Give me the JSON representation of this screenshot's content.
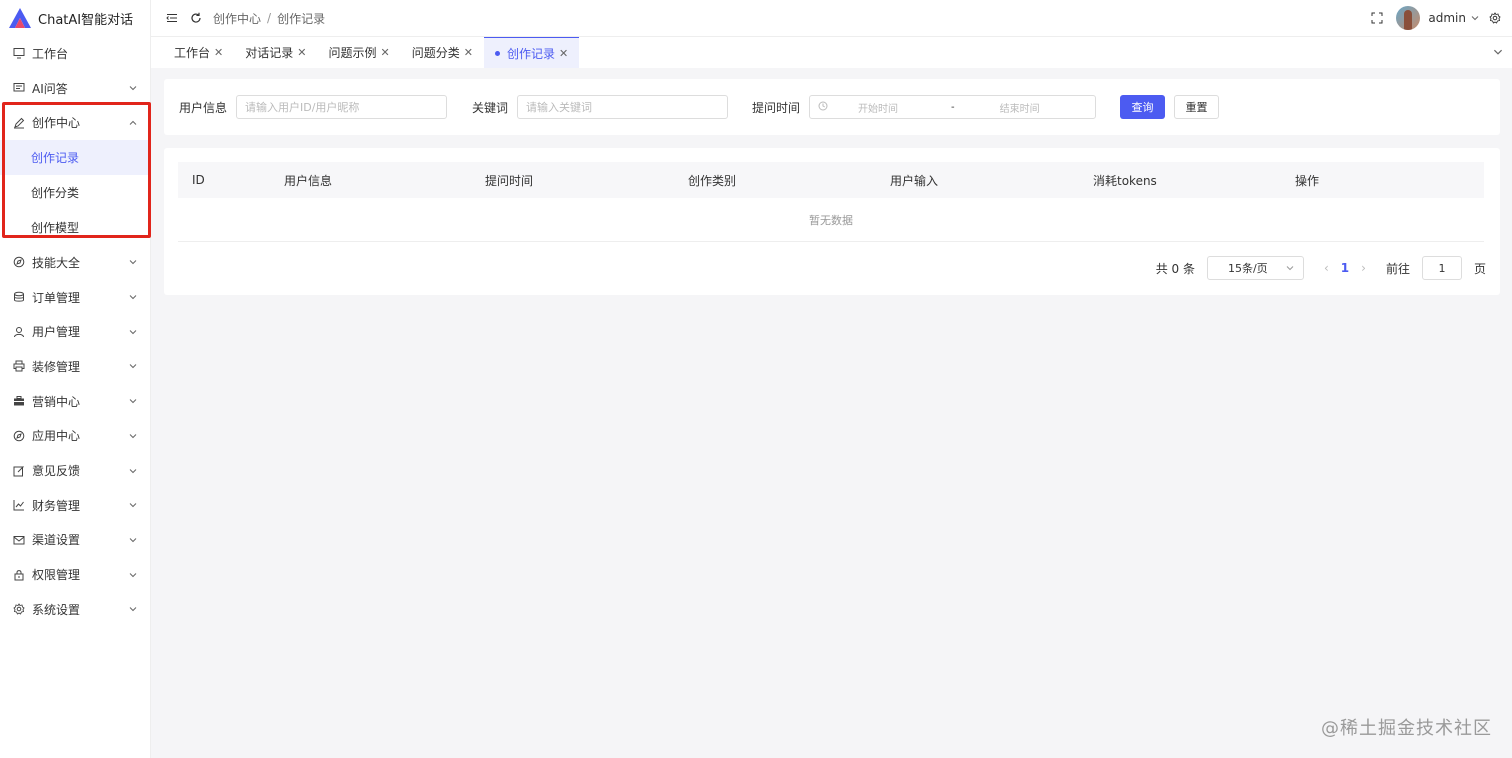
{
  "app": {
    "title": "ChatAI智能对话"
  },
  "colors": {
    "accent": "#4c5bf1",
    "highlight_border": "#e1251b"
  },
  "sidebar": {
    "items": [
      {
        "label": "工作台",
        "icon": "monitor-icon",
        "expandable": false
      },
      {
        "label": "AI问答",
        "icon": "chat-icon",
        "expandable": true
      },
      {
        "label": "创作中心",
        "icon": "pen-icon",
        "expandable": true,
        "expanded": true,
        "children": [
          {
            "label": "创作记录",
            "active": true
          },
          {
            "label": "创作分类"
          },
          {
            "label": "创作模型"
          }
        ]
      },
      {
        "label": "技能大全",
        "icon": "compass-icon",
        "expandable": true
      },
      {
        "label": "订单管理",
        "icon": "database-icon",
        "expandable": true
      },
      {
        "label": "用户管理",
        "icon": "user-icon",
        "expandable": true
      },
      {
        "label": "装修管理",
        "icon": "printer-icon",
        "expandable": true
      },
      {
        "label": "营销中心",
        "icon": "briefcase-icon",
        "expandable": true
      },
      {
        "label": "应用中心",
        "icon": "compass-icon",
        "expandable": true
      },
      {
        "label": "意见反馈",
        "icon": "edit-icon",
        "expandable": true
      },
      {
        "label": "财务管理",
        "icon": "chart-icon",
        "expandable": true
      },
      {
        "label": "渠道设置",
        "icon": "mail-icon",
        "expandable": true
      },
      {
        "label": "权限管理",
        "icon": "lock-icon",
        "expandable": true
      },
      {
        "label": "系统设置",
        "icon": "gear-icon",
        "expandable": true
      }
    ]
  },
  "header": {
    "breadcrumb": [
      "创作中心",
      "创作记录"
    ],
    "username": "admin"
  },
  "tabs": [
    {
      "label": "工作台",
      "active": false
    },
    {
      "label": "对话记录",
      "active": false
    },
    {
      "label": "问题示例",
      "active": false
    },
    {
      "label": "问题分类",
      "active": false
    },
    {
      "label": "创作记录",
      "active": true
    }
  ],
  "filter": {
    "user_label": "用户信息",
    "user_placeholder": "请输入用户ID/用户昵称",
    "keyword_label": "关键词",
    "keyword_placeholder": "请输入关键词",
    "time_label": "提问时间",
    "start_placeholder": "开始时间",
    "range_sep": "-",
    "end_placeholder": "结束时间",
    "query_button": "查询",
    "reset_button": "重置"
  },
  "table": {
    "columns": [
      "ID",
      "用户信息",
      "提问时间",
      "创作类别",
      "用户输入",
      "消耗tokens",
      "操作"
    ],
    "empty_text": "暂无数据"
  },
  "pagination": {
    "total_text": "共 0 条",
    "page_size": "15条/页",
    "current_page": "1",
    "goto_label": "前往",
    "goto_value": "1",
    "page_unit": "页"
  },
  "watermark": "@稀土掘金技术社区"
}
